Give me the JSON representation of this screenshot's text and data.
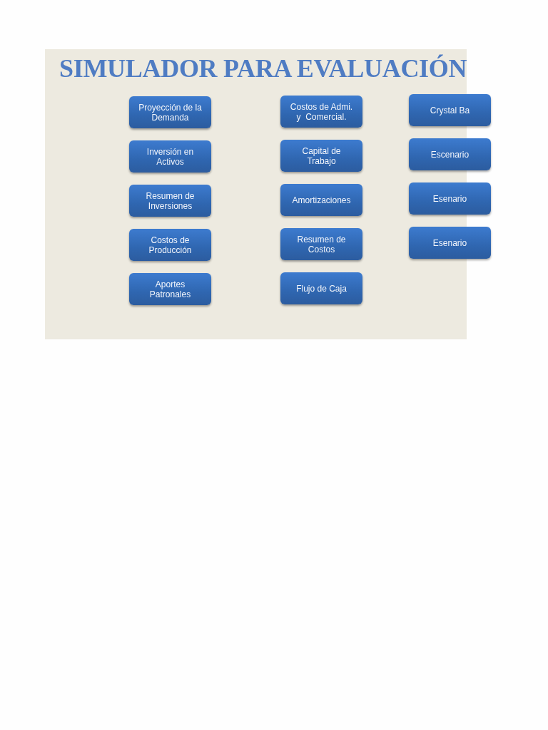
{
  "title": "SIMULADOR PARA EVALUACIÓN",
  "columns": [
    {
      "buttons": [
        {
          "label": "Proyección de la\nDemanda"
        },
        {
          "label": "Inversión en\nActivos"
        },
        {
          "label": "Resumen de\nInversiones"
        },
        {
          "label": "Costos de\nProducción"
        },
        {
          "label": "Aportes\nPatronales"
        }
      ]
    },
    {
      "buttons": [
        {
          "label": "Costos de Admi.\ny  Comercial."
        },
        {
          "label": "Capital de\nTrabajo"
        },
        {
          "label": "Amortizaciones"
        },
        {
          "label": "Resumen de\nCostos"
        },
        {
          "label": "Flujo de Caja"
        }
      ]
    },
    {
      "buttons": [
        {
          "label": "Crystal Ba"
        },
        {
          "label": "Escenario"
        },
        {
          "label": "Esenario"
        },
        {
          "label": "Esenario"
        }
      ]
    }
  ]
}
